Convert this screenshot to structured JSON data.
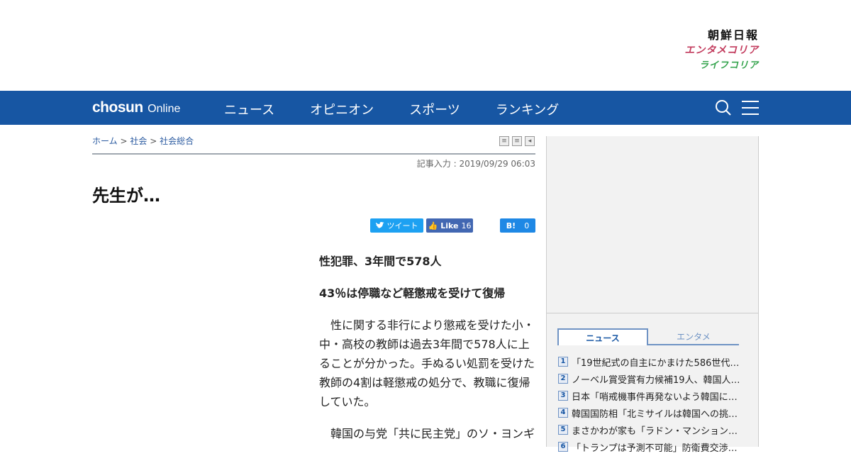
{
  "brands": [
    "朝鮮日報",
    "エンタメコリア",
    "ライフコリア"
  ],
  "nav": {
    "logo_bold": "chosun",
    "logo_light": "Online",
    "menu": [
      "ニュース",
      "オピニオン",
      "スポーツ",
      "ランキング"
    ]
  },
  "breadcrumb": {
    "home": "ホーム",
    "sep": ">",
    "level1": "社会",
    "level2": "社会総合"
  },
  "article": {
    "date": "記事入力 : 2019/09/29 06:03",
    "title": "先生が…",
    "subheads": [
      "性犯罪、3年間で578人",
      "43％は停職など軽懲戒を受けて復帰"
    ],
    "paragraphs": [
      "性に関する非行により懲戒を受けた小・中・高校の教師は過去3年間で578人に上ることが分かった。手ぬるい処罰を受けた教師の4割は軽懲戒の処分で、教職に復帰していた。",
      "韓国の与党「共に民主党」のソ・ヨンギ"
    ]
  },
  "share": {
    "tweet": "ツイート",
    "like": "Like",
    "like_count": "16",
    "hatena": "B!",
    "hatena_count": "0"
  },
  "sidebar": {
    "tabs": [
      "ニュース",
      "エンタメ"
    ],
    "ranking": [
      {
        "num": "1",
        "text": "「19世紀式の自主にかまけた586世代…"
      },
      {
        "num": "2",
        "text": "ノーベル賞受賞有力候補19人、韓国人…"
      },
      {
        "num": "3",
        "text": "日本「哨戒機事件再発ないよう韓国に…"
      },
      {
        "num": "4",
        "text": "韓国国防相「北ミサイルは韓国への挑…"
      },
      {
        "num": "5",
        "text": "まさかわが家も「ラドン・マンション…"
      },
      {
        "num": "6",
        "text": "「トランプは予測不可能」防衛費交渉…"
      }
    ]
  }
}
